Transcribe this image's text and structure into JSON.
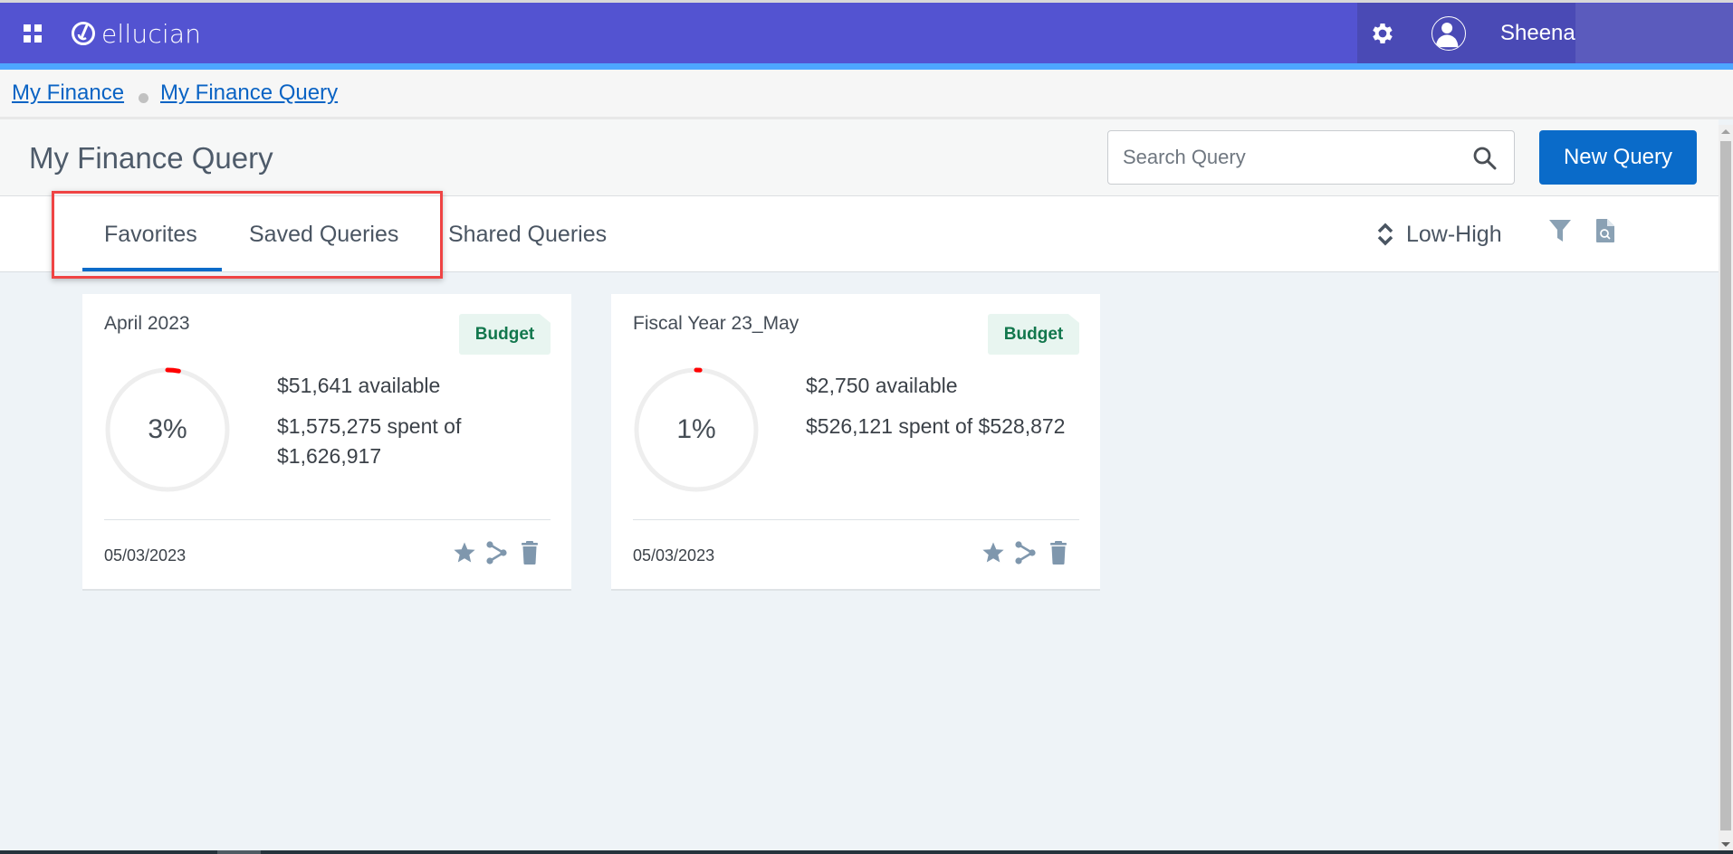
{
  "header": {
    "app_name": "ellucian",
    "username": "Sheena",
    "icons": [
      "apps-grid-icon",
      "ellucian-logo-icon",
      "gear-icon",
      "user-avatar-icon"
    ],
    "colors": {
      "header_bg": "#5353d1",
      "accent_strip": "#4da6ff"
    }
  },
  "breadcrumb": {
    "items": [
      {
        "label": "My Finance"
      },
      {
        "label": "My Finance Query"
      }
    ]
  },
  "page": {
    "title": "My Finance Query",
    "search": {
      "placeholder": "Search Query",
      "value": ""
    },
    "new_query_label": "New Query",
    "primary_color": "#0a6bc9"
  },
  "tabs": {
    "items": [
      {
        "label": "Favorites",
        "active": true
      },
      {
        "label": "Saved Queries",
        "active": false
      },
      {
        "label": "Shared Queries",
        "active": false
      }
    ],
    "sort_label": "Low-High",
    "icons": [
      "sort-icon",
      "filter-icon",
      "document-search-icon"
    ]
  },
  "cards": [
    {
      "name": "April 2023",
      "badge": "Budget",
      "percent_label": "3%",
      "percent_value": 3,
      "available": "$51,641 available",
      "spent": "$1,575,275 spent of $1,626,917",
      "date": "05/03/2023"
    },
    {
      "name": "Fiscal Year 23_May",
      "badge": "Budget",
      "percent_label": "1%",
      "percent_value": 1,
      "available": "$2,750 available",
      "spent": "$526,121 spent of $528,872",
      "date": "05/03/2023"
    }
  ],
  "card_actions": [
    "favorite-star-icon",
    "share-icon",
    "delete-trash-icon"
  ],
  "colors": {
    "progress_arc": "#ff0000",
    "badge_text": "#12774d",
    "badge_bg": "#e8f5f0"
  }
}
